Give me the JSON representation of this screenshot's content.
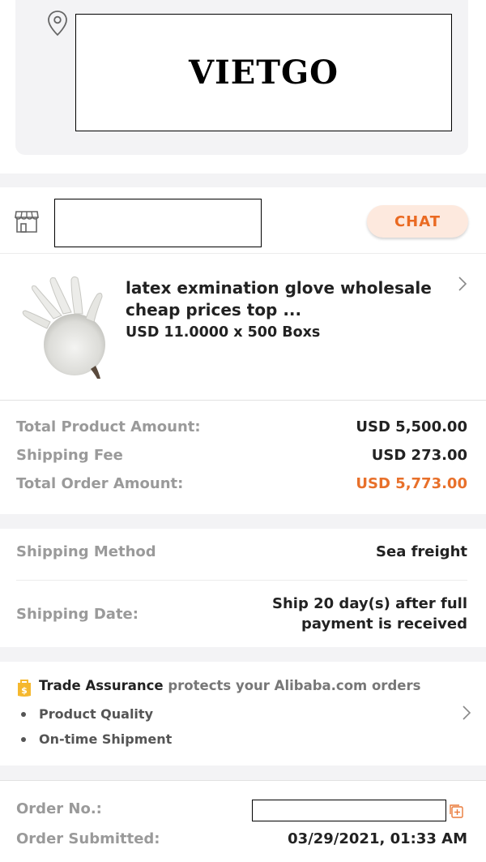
{
  "address": {
    "logo_text": "VIETGO"
  },
  "seller": {
    "chat_label": "CHAT"
  },
  "product": {
    "title": "latex exmination glove wholesale cheap prices top ...",
    "price_line": "USD 11.0000 x 500 Boxs"
  },
  "totals": {
    "product_amount_label": "Total Product Amount:",
    "product_amount_value": "USD 5,500.00",
    "shipping_fee_label": "Shipping Fee",
    "shipping_fee_value": "USD 273.00",
    "order_amount_label": "Total Order Amount:",
    "order_amount_value": "USD 5,773.00"
  },
  "shipping": {
    "method_label": "Shipping Method",
    "method_value": "Sea freight",
    "date_label": "Shipping Date:",
    "date_value_line1": "Ship 20 day(s) after full",
    "date_value_line2": "payment is received"
  },
  "trade_assurance": {
    "title": "Trade Assurance",
    "subtitle": "protects your Alibaba.com orders",
    "bullets": [
      "Product Quality",
      "On-time Shipment"
    ]
  },
  "order": {
    "number_label": "Order No.:",
    "submitted_label": "Order Submitted:",
    "submitted_value": "03/29/2021, 01:33 AM"
  },
  "colors": {
    "accent": "#e8702a",
    "chat_bg": "#fde9de",
    "label_gray": "#9a9a9a",
    "page_bg": "#f3f3f5"
  }
}
